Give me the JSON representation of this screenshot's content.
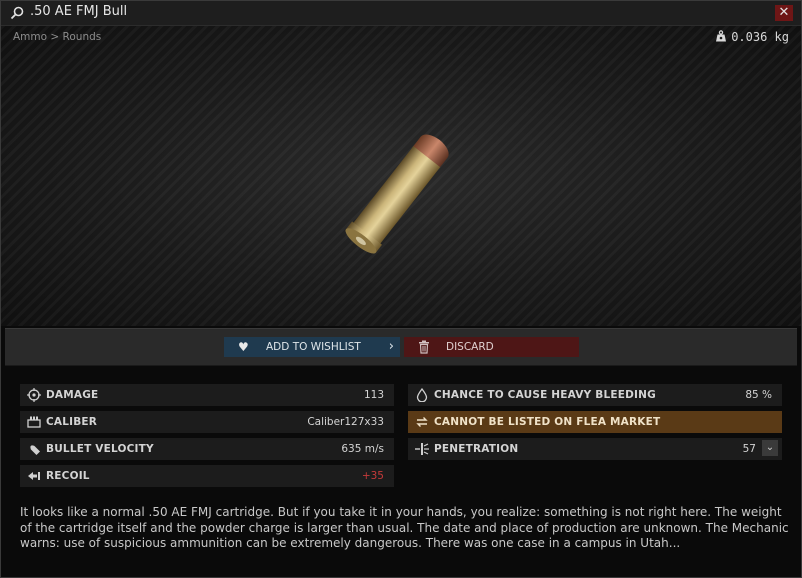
{
  "window": {
    "title": ".50 AE FMJ Bull",
    "close_symbol": "✕"
  },
  "preview": {
    "breadcrumb": "Ammo > Rounds",
    "weight": "0.036 kg",
    "item_image": "cartridge-image"
  },
  "actions": {
    "wishlist_label": "ADD TO WISHLIST",
    "discard_label": "DISCARD"
  },
  "stats": {
    "damage": {
      "label": "DAMAGE",
      "value": "113"
    },
    "caliber": {
      "label": "CALIBER",
      "value": "Caliber127x33"
    },
    "bullet_velocity": {
      "label": "BULLET VELOCITY",
      "value": "635 m/s"
    },
    "recoil": {
      "label": "RECOIL",
      "value": "+35"
    },
    "heavy_bleeding": {
      "label": "CHANCE TO CAUSE HEAVY BLEEDING",
      "value": "85 %"
    },
    "flea": {
      "label": "CANNOT BE LISTED ON FLEA MARKET"
    },
    "penetration": {
      "label": "PENETRATION",
      "value": "57"
    }
  },
  "description": "It looks like a normal .50 AE FMJ cartridge. But if you take it in your hands, you realize: something is not right here. The weight of the cartridge itself and the powder charge is larger than usual. The date and place of production are unknown. The Mechanic warns: use of suspicious ammunition can be extremely dangerous. There was one case in a campus in Utah...",
  "colors": {
    "wishlist_bg": "#1f3a4f",
    "discard_bg": "#4e1616",
    "flea_bg": "#5a3a16",
    "recoil_value": "#c53a3a",
    "close_bg": "#6e1616"
  }
}
